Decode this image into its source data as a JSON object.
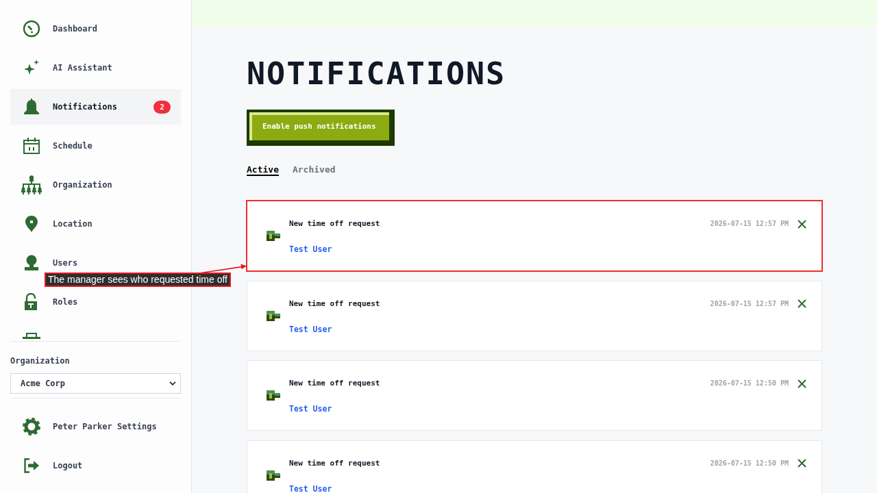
{
  "sidebar": {
    "nav_items": [
      {
        "label": "Dashboard",
        "selected": false
      },
      {
        "label": "AI Assistant",
        "selected": false
      },
      {
        "label": "Notifications",
        "selected": true,
        "badge": "2"
      },
      {
        "label": "Schedule",
        "selected": false
      },
      {
        "label": "Organization",
        "selected": false
      },
      {
        "label": "Location",
        "selected": false
      },
      {
        "label": "Users",
        "selected": false
      },
      {
        "label": "Roles",
        "selected": false
      }
    ],
    "organization": {
      "label": "Organization",
      "value": "Acme Corp"
    },
    "footer_items": [
      {
        "label": "Peter Parker Settings"
      },
      {
        "label": "Logout"
      }
    ]
  },
  "page": {
    "title": "NOTIFICATIONS",
    "push_button": "Enable push notifications",
    "tabs": [
      {
        "label": "Active",
        "selected": true
      },
      {
        "label": "Archived",
        "selected": false
      }
    ],
    "notifications": [
      {
        "title": "New time off request",
        "user": "Test User",
        "time": "2026-07-15 12:57 PM",
        "annotated": true
      },
      {
        "title": "New time off request",
        "user": "Test User",
        "time": "2026-07-15 12:57 PM",
        "annotated": false
      },
      {
        "title": "New time off request",
        "user": "Test User",
        "time": "2026-07-15 12:50 PM",
        "annotated": false
      },
      {
        "title": "New time off request",
        "user": "Test User",
        "time": "2026-07-15 12:50 PM",
        "annotated": false
      }
    ]
  },
  "annotation": {
    "text": "The manager sees who requested time off"
  }
}
